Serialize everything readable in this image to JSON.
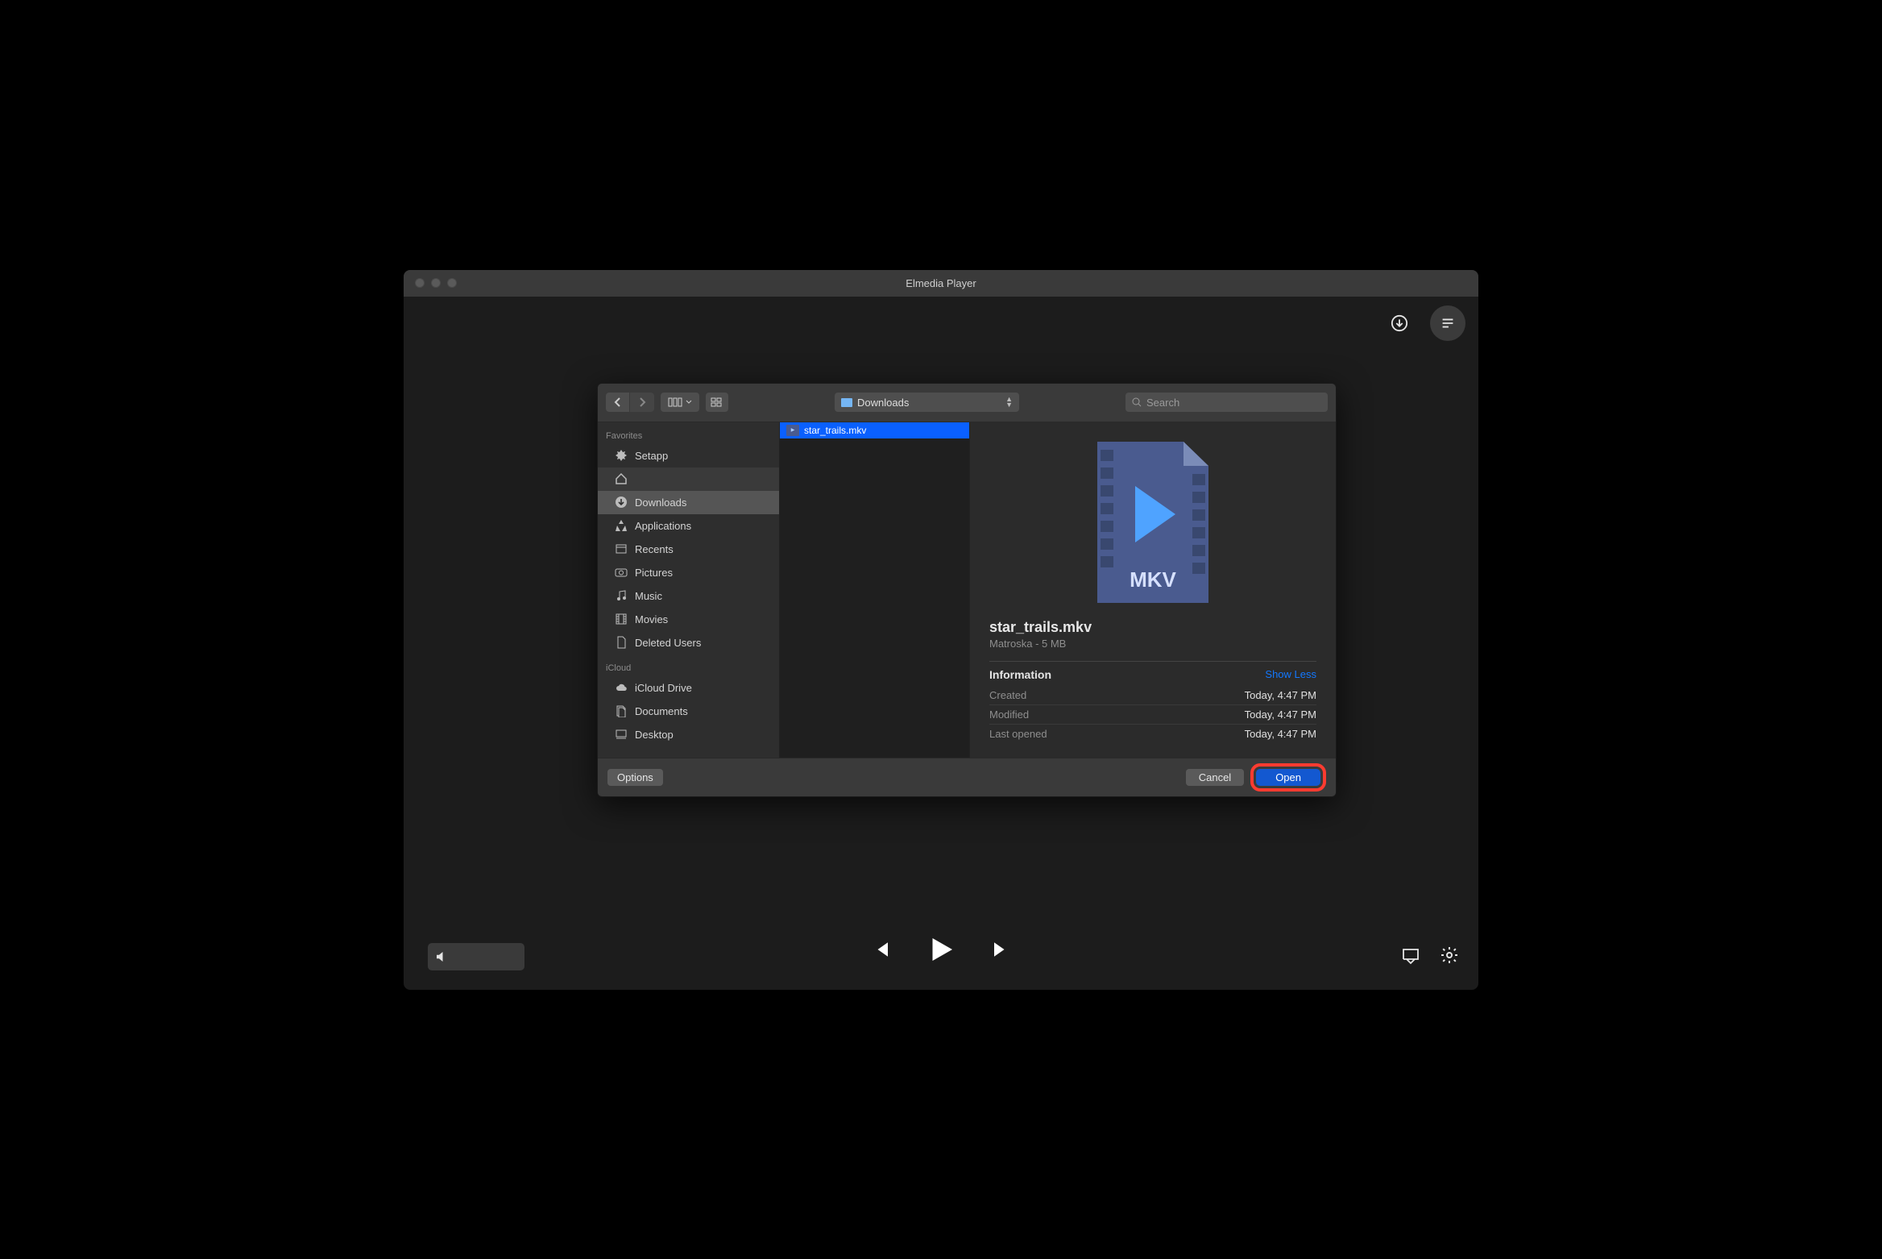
{
  "window": {
    "title": "Elmedia Player"
  },
  "dialog": {
    "location": "Downloads",
    "search_placeholder": "Search",
    "sidebar": {
      "sections": [
        {
          "label": "Favorites",
          "items": [
            {
              "label": "Setapp",
              "icon": "setapp"
            },
            {
              "label": "",
              "icon": "home",
              "dim": true
            },
            {
              "label": "Downloads",
              "icon": "download",
              "selected": true
            },
            {
              "label": "Applications",
              "icon": "apps"
            },
            {
              "label": "Recents",
              "icon": "recents"
            },
            {
              "label": "Pictures",
              "icon": "camera"
            },
            {
              "label": "Music",
              "icon": "music"
            },
            {
              "label": "Movies",
              "icon": "film"
            },
            {
              "label": "Deleted Users",
              "icon": "doc"
            }
          ]
        },
        {
          "label": "iCloud",
          "items": [
            {
              "label": "iCloud Drive",
              "icon": "cloud"
            },
            {
              "label": "Documents",
              "icon": "documents"
            },
            {
              "label": "Desktop",
              "icon": "desktop"
            }
          ]
        }
      ]
    },
    "files": [
      {
        "name": "star_trails.mkv",
        "selected": true
      }
    ],
    "preview": {
      "icon_label": "MKV",
      "name": "star_trails.mkv",
      "subtitle": "Matroska - 5 MB",
      "info_label": "Information",
      "show_less_label": "Show Less",
      "rows": [
        {
          "key": "Created",
          "val": "Today, 4:47 PM"
        },
        {
          "key": "Modified",
          "val": "Today, 4:47 PM"
        },
        {
          "key": "Last opened",
          "val": "Today, 4:47 PM"
        }
      ]
    },
    "footer": {
      "options_label": "Options",
      "cancel_label": "Cancel",
      "open_label": "Open"
    }
  }
}
